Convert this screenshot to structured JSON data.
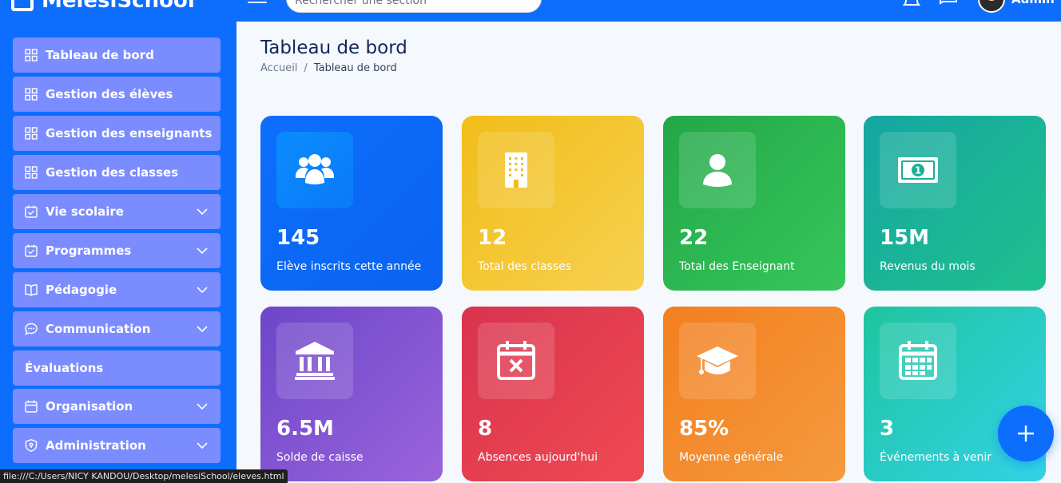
{
  "header": {
    "brand": "MelesiSchool",
    "search_placeholder": "Rechercher une section",
    "user_label": "Admin"
  },
  "sidebar": {
    "items": [
      {
        "label": "Tableau de bord",
        "icon": "grid-icon",
        "expandable": false
      },
      {
        "label": "Gestion des élèves",
        "icon": "grid-icon",
        "expandable": false
      },
      {
        "label": "Gestion des enseignants",
        "icon": "grid-icon",
        "expandable": false
      },
      {
        "label": "Gestion des classes",
        "icon": "grid-icon",
        "expandable": false
      },
      {
        "label": "Vie scolaire",
        "icon": "calendar-check-icon",
        "expandable": true
      },
      {
        "label": "Programmes",
        "icon": "calendar-check-icon",
        "expandable": true
      },
      {
        "label": "Pédagogie",
        "icon": "book-icon",
        "expandable": true
      },
      {
        "label": "Communication",
        "icon": "chat-icon",
        "expandable": true
      },
      {
        "label": "Évaluations",
        "icon": "",
        "expandable": false
      },
      {
        "label": "Organisation",
        "icon": "calendar-icon",
        "expandable": true
      },
      {
        "label": "Administration",
        "icon": "shield-icon",
        "expandable": true
      }
    ]
  },
  "main": {
    "title": "Tableau de bord",
    "breadcrumb": {
      "home": "Accueil",
      "separator": "/",
      "current": "Tableau de bord"
    },
    "cards": [
      {
        "value": "145",
        "label": "Elève inscrits cette année",
        "icon": "users-icon",
        "color": "#0d6efd"
      },
      {
        "value": "12",
        "label": "Total des classes",
        "icon": "building-icon",
        "color": "#f4c021"
      },
      {
        "value": "22",
        "label": "Total des Enseignant",
        "icon": "user-icon",
        "color": "#28b34f"
      },
      {
        "value": "15M",
        "label": "Revenus du mois",
        "icon": "money-icon",
        "color": "#17b097"
      },
      {
        "value": "6.5M",
        "label": "Solde de caisse",
        "icon": "bank-icon",
        "color": "#7a4fd0"
      },
      {
        "value": "8",
        "label": "Absences aujourd'hui",
        "icon": "calendar-x-icon",
        "color": "#e3394e"
      },
      {
        "value": "85%",
        "label": "Moyenne générale",
        "icon": "graduation-cap-icon",
        "color": "#f3832a"
      },
      {
        "value": "3",
        "label": "Événements à venir",
        "icon": "calendar-grid-icon",
        "color": "#20c4b0"
      }
    ]
  },
  "status_url": "file:///C:/Users/NICY KANDOU/Desktop/melesiSchool/eleves.html"
}
